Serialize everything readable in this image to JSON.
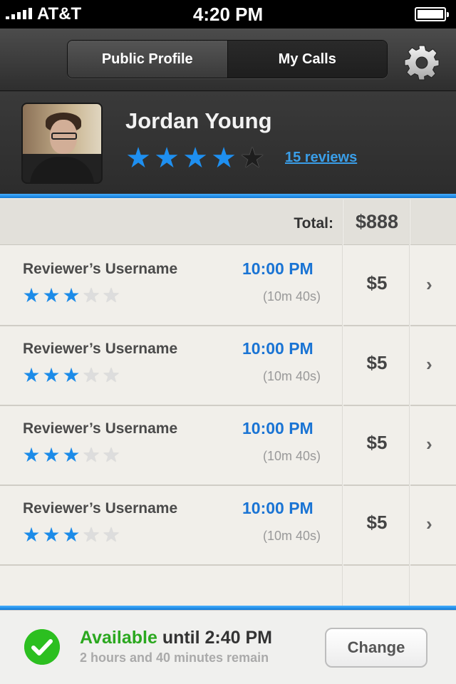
{
  "status_bar": {
    "carrier": "AT&T",
    "time": "4:20 PM"
  },
  "nav": {
    "tabs": [
      {
        "label": "Public Profile",
        "selected": false
      },
      {
        "label": "My Calls",
        "selected": true
      }
    ],
    "settings_icon": "gear-icon"
  },
  "profile": {
    "name": "Jordan Young",
    "rating": 4,
    "rating_max": 5,
    "reviews_link": "15 reviews"
  },
  "calls": {
    "total_label": "Total:",
    "total_value": "$888",
    "rows": [
      {
        "username": "Reviewer’s Username",
        "time": "10:00 PM",
        "duration": "(10m 40s)",
        "rating": 3,
        "price": "$5"
      },
      {
        "username": "Reviewer’s Username",
        "time": "10:00 PM",
        "duration": "(10m 40s)",
        "rating": 3,
        "price": "$5"
      },
      {
        "username": "Reviewer’s Username",
        "time": "10:00 PM",
        "duration": "(10m 40s)",
        "rating": 3,
        "price": "$5"
      },
      {
        "username": "Reviewer’s Username",
        "time": "10:00 PM",
        "duration": "(10m 40s)",
        "rating": 3,
        "price": "$5"
      }
    ]
  },
  "availability": {
    "status": "Available",
    "until": "until 2:40 PM",
    "remaining": "2 hours and 40 minutes remain",
    "change_label": "Change"
  },
  "colors": {
    "accent_blue": "#1a74d4",
    "available_green": "#2ba81f"
  }
}
